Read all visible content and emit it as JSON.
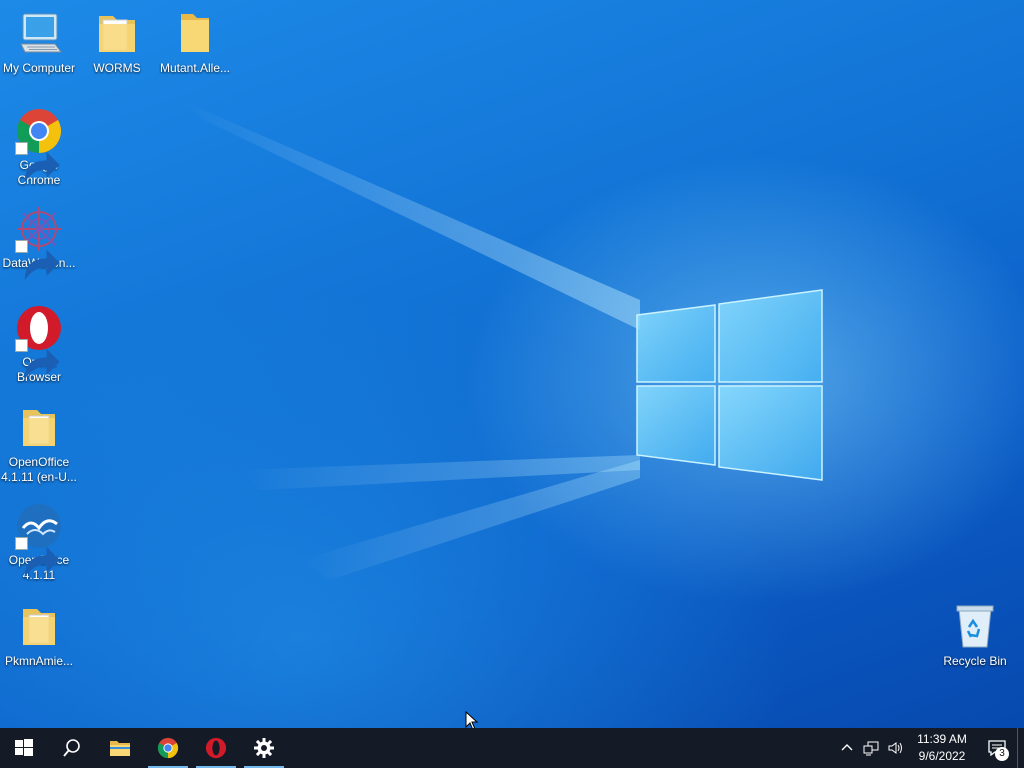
{
  "desktop": {
    "icons": [
      {
        "label": "My Computer",
        "icon": "computer-icon",
        "shortcut": false
      },
      {
        "label": "WORMS",
        "icon": "folder-icon",
        "shortcut": false
      },
      {
        "label": "Mutant.Alle...",
        "icon": "folder-icon",
        "shortcut": false
      },
      {
        "label": "Google Chrome",
        "icon": "chrome-icon",
        "shortcut": true
      },
      {
        "label": "DataWagon...",
        "icon": "datawagon-icon",
        "shortcut": true
      },
      {
        "label": "Opera Browser",
        "icon": "opera-icon",
        "shortcut": true
      },
      {
        "label": "OpenOffice 4.1.11 (en-U...",
        "icon": "folder-icon",
        "shortcut": false
      },
      {
        "label": "OpenOffice 4.1.11",
        "icon": "openoffice-icon",
        "shortcut": true
      },
      {
        "label": "PkmnAmie...",
        "icon": "folder-icon",
        "shortcut": false
      },
      {
        "label": "Recycle Bin",
        "icon": "recycle-bin-icon",
        "shortcut": false
      }
    ]
  },
  "taskbar": {
    "buttons": [
      {
        "name": "start-button",
        "icon": "windows-logo-icon",
        "running": false
      },
      {
        "name": "search-button",
        "icon": "search-icon",
        "running": false
      },
      {
        "name": "file-explorer-button",
        "icon": "folder-icon",
        "running": false
      },
      {
        "name": "chrome-button",
        "icon": "chrome-icon",
        "running": true
      },
      {
        "name": "opera-button",
        "icon": "opera-icon",
        "running": true
      },
      {
        "name": "settings-button",
        "icon": "gear-icon",
        "running": true
      }
    ],
    "tray": {
      "icons": [
        "chevron-up-icon",
        "network-icon",
        "volume-icon"
      ],
      "time": "11:39 AM",
      "date": "9/6/2022",
      "notification_count": "3"
    }
  },
  "colors": {
    "taskbar_bg": "#141b26",
    "running_indicator": "#76b9ed",
    "desktop_blue": "#1274d6"
  }
}
